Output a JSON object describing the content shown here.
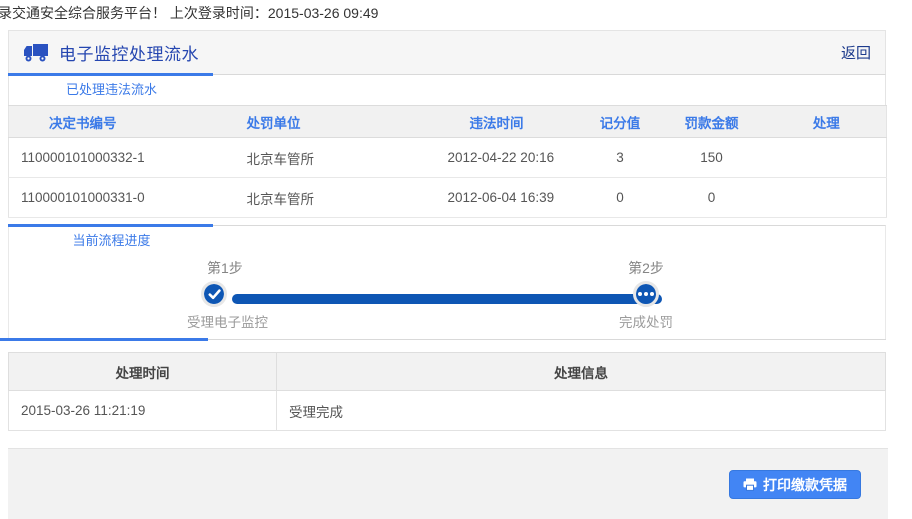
{
  "topbar": {
    "welcome_text": "录交通安全综合服务平台！ 上次登录时间：2015-03-26 09:49"
  },
  "header": {
    "title": "电子监控处理流水",
    "icon": "truck-icon",
    "back_label": "返回"
  },
  "violations": {
    "tab_label": "已处理违法流水",
    "table": {
      "columns": [
        "决定书编号",
        "处罚单位",
        "违法时间",
        "记分值",
        "罚款金额",
        "处理"
      ],
      "rows": [
        {
          "decision_no": "110000101000332-1",
          "unit": "北京车管所",
          "time": "2012-04-22 20:16",
          "points": "3",
          "fine": "150",
          "action": ""
        },
        {
          "decision_no": "110000101000331-0",
          "unit": "北京车管所",
          "time": "2012-06-04 16:39",
          "points": "0",
          "fine": "0",
          "action": ""
        }
      ]
    }
  },
  "progress": {
    "tab_label": "当前流程进度",
    "steps": [
      {
        "step_label": "第1步",
        "name": "受理电子监控",
        "status": "completed",
        "icon": "check-icon"
      },
      {
        "step_label": "第2步",
        "name": "完成处罚",
        "status": "pending",
        "icon": "ellipsis-icon"
      }
    ]
  },
  "process_log": {
    "columns": [
      "处理时间",
      "处理信息"
    ],
    "rows": [
      {
        "time": "2015-03-26 11:21:19",
        "info": "受理完成"
      }
    ]
  },
  "footer": {
    "print_button": {
      "label": "打印缴款凭据",
      "icon": "printer-icon"
    }
  },
  "colors": {
    "accent_blue": "#3b7ae8",
    "deep_blue": "#0e56b4",
    "button_blue": "#4285f4",
    "title_blue": "#2546b0"
  }
}
